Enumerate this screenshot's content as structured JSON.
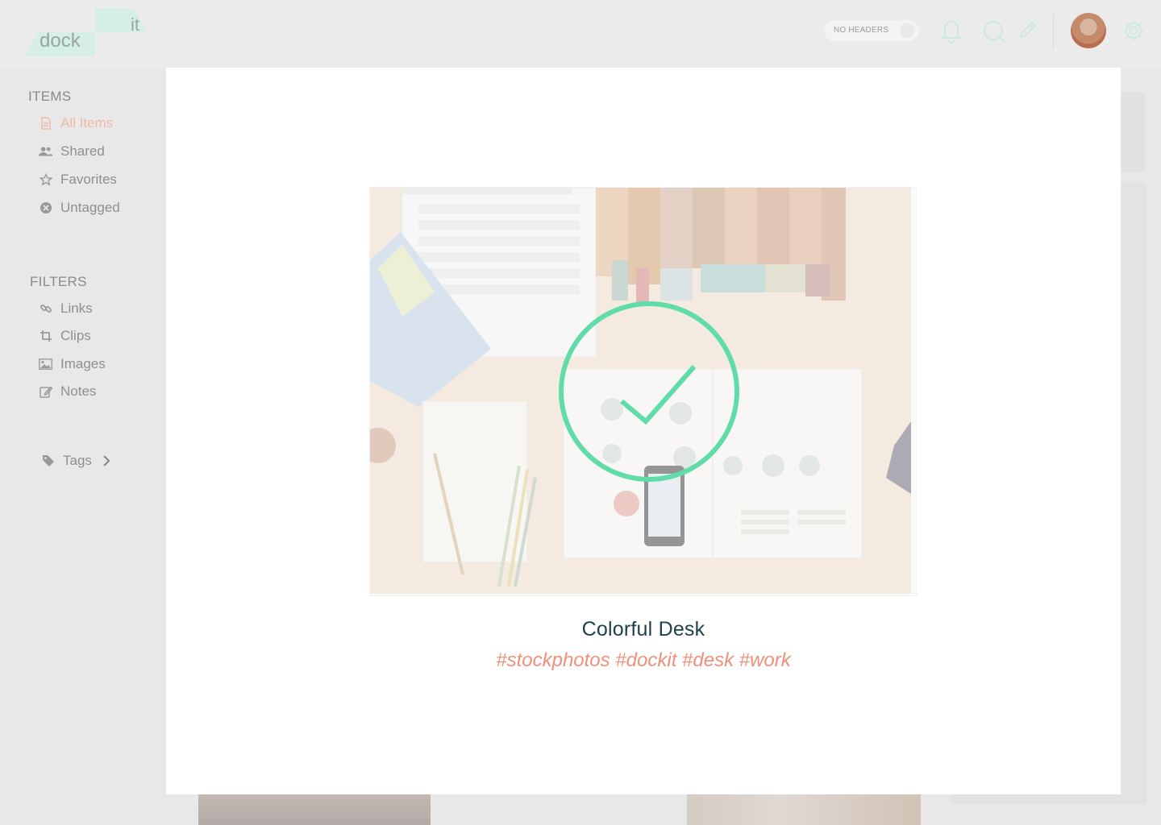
{
  "header": {
    "logo_top": "it",
    "logo_bottom": "dock",
    "toggle_label": "NO HEADERS",
    "icons": [
      "bell-icon",
      "search-icon",
      "pencil-icon",
      "avatar",
      "gear-icon"
    ]
  },
  "sidebar": {
    "items_title": "ITEMS",
    "items": [
      {
        "label": "All Items",
        "icon": "document-icon",
        "active": true
      },
      {
        "label": "Shared",
        "icon": "users-icon",
        "active": false
      },
      {
        "label": "Favorites",
        "icon": "star-icon",
        "active": false
      },
      {
        "label": "Untagged",
        "icon": "untagged-icon",
        "active": false
      }
    ],
    "filters_title": "FILTERS",
    "filters": [
      {
        "label": "Links",
        "icon": "link-icon"
      },
      {
        "label": "Clips",
        "icon": "crop-icon"
      },
      {
        "label": "Images",
        "icon": "image-icon"
      },
      {
        "label": "Notes",
        "icon": "edit-icon"
      }
    ],
    "tags_label": "Tags"
  },
  "modal": {
    "title": "Colorful Desk",
    "tags": "#stockphotos #dockit #desk #work",
    "status_icon": "checkmark-circle-icon"
  },
  "colors": {
    "accent_green": "#5fdca8",
    "tag_salmon": "#f0907a",
    "title_dark": "#20404a",
    "active_nav": "#f0b9a8"
  }
}
